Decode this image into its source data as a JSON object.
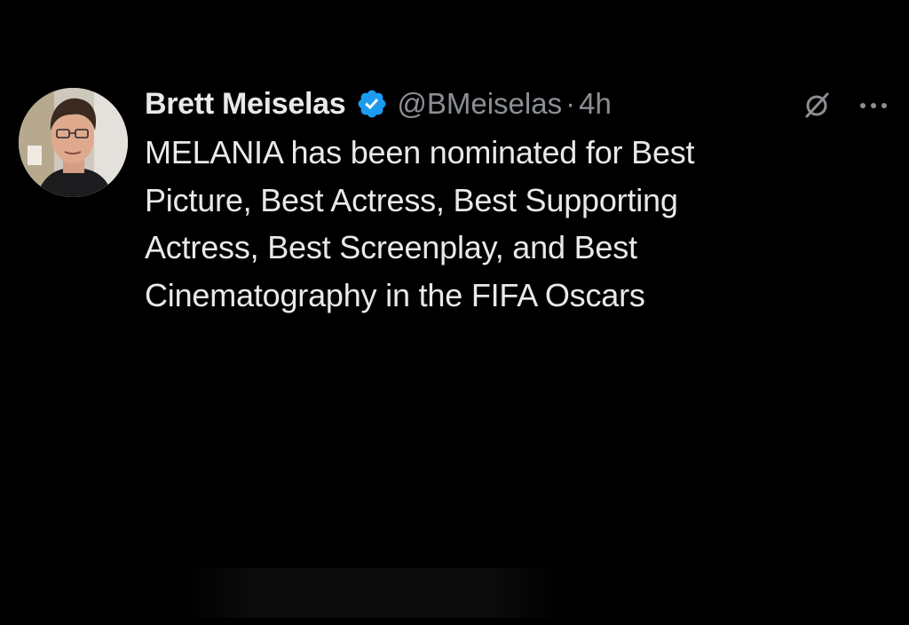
{
  "tweet": {
    "author": {
      "display_name": "Brett Meiselas",
      "handle": "@BMeiselas",
      "verified": true,
      "avatar_icon": "user-avatar"
    },
    "separator": "·",
    "timestamp": "4h",
    "text_lines": [
      "MELANIA has been nominated for Best",
      "Picture, Best Actress, Best Supporting",
      "Actress, Best Screenplay, and Best",
      "Cinematography in the FIFA Oscars"
    ],
    "actions": {
      "grok_icon": "grok-icon",
      "more_icon": "more-options-icon"
    }
  },
  "colors": {
    "background": "#000000",
    "primary_text": "#e7e9ea",
    "secondary_text": "#8b8f94",
    "verified_badge": "#1d9bf0"
  }
}
